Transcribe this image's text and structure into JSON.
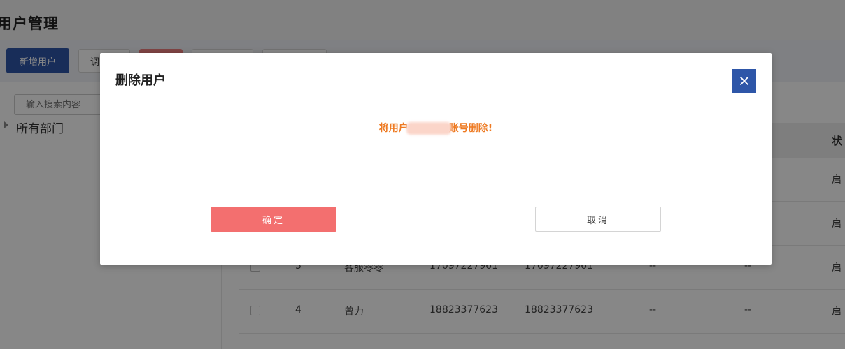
{
  "page": {
    "title": "用户管理"
  },
  "toolbar": {
    "add_user_label": "新增用户",
    "second_button_label": "调"
  },
  "sidebar": {
    "search_placeholder": "输入搜索内容",
    "tree_root_label": "所有部门"
  },
  "table": {
    "status_header": "状",
    "rows": [
      {
        "index": "",
        "name": "",
        "phone": "",
        "account": "",
        "col5": "",
        "col6": "",
        "status": "启"
      },
      {
        "index": "",
        "name": "",
        "phone": "",
        "account": "",
        "col5": "",
        "col6": "",
        "status": "启"
      },
      {
        "index": "3",
        "name": "客服零零",
        "phone": "17097227961",
        "account": "17097227961",
        "col5": "--",
        "col6": "--",
        "status": "启"
      },
      {
        "index": "4",
        "name": "曾力",
        "phone": "18823377623",
        "account": "18823377623",
        "col5": "--",
        "col6": "--",
        "status": "启"
      }
    ]
  },
  "modal": {
    "title": "删除用户",
    "message_prefix": "将用户",
    "message_suffix": "账号删除!",
    "confirm_label": "确定",
    "cancel_label": "取消"
  },
  "colors": {
    "primary": "#2e56a8",
    "danger": "#f36f6f",
    "warning_text": "#ee7a22"
  },
  "icons": {
    "close": "close-icon",
    "tree_expand": "caret-right-icon"
  }
}
